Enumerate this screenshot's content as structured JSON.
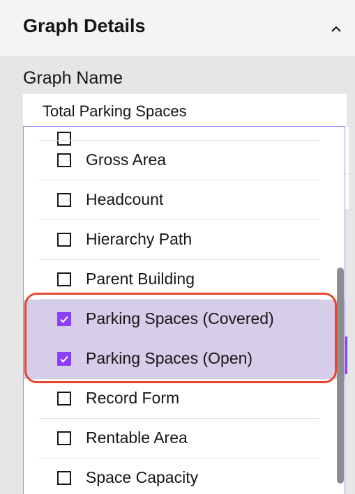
{
  "panel": {
    "title": "Graph Details",
    "collapse_icon": "chevron-up-icon"
  },
  "graph_name": {
    "label": "Graph Name",
    "value": "Total Parking Spaces"
  },
  "dropdown": {
    "options": [
      {
        "label": "Gross Area",
        "checked": false
      },
      {
        "label": "Headcount",
        "checked": false
      },
      {
        "label": "Hierarchy Path",
        "checked": false
      },
      {
        "label": "Parent Building",
        "checked": false
      },
      {
        "label": "Parking Spaces (Covered)",
        "checked": true
      },
      {
        "label": "Parking Spaces (Open)",
        "checked": true
      },
      {
        "label": "Record Form",
        "checked": false
      },
      {
        "label": "Rentable Area",
        "checked": false
      },
      {
        "label": "Space Capacity",
        "checked": false
      }
    ]
  },
  "colors": {
    "accent": "#8a3ffc",
    "selected_row": "#d6cde8",
    "highlight_ring": "#e8472f"
  }
}
